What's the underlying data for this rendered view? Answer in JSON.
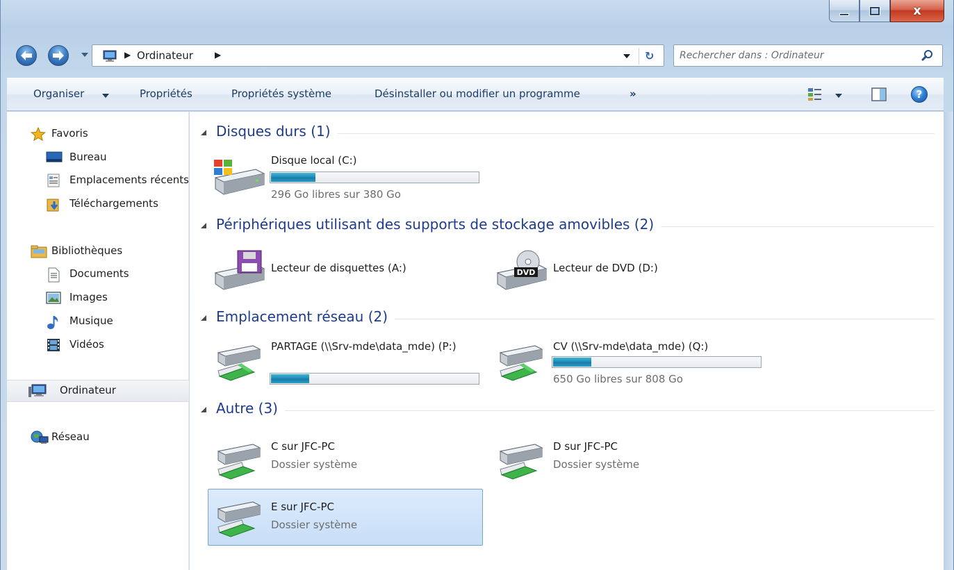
{
  "window": {
    "close_glyph": "x",
    "colors": {
      "accent": "#1e3c8c",
      "bar_fill": "#1f89b6",
      "selection": "#c7def7"
    }
  },
  "address": {
    "crumb": "Ordinateur",
    "chevron": "▶"
  },
  "search": {
    "placeholder": "Rechercher dans : Ordinateur"
  },
  "commands": {
    "organise": "Organiser",
    "properties": "Propriétés",
    "system_properties": "Propriétés système",
    "uninstall": "Désinstaller ou modifier un programme",
    "more": "»",
    "help": "?"
  },
  "nav": {
    "favorites": "Favoris",
    "desktop": "Bureau",
    "recent_places": "Emplacements récents",
    "downloads": "Téléchargements",
    "libraries": "Bibliothèques",
    "documents": "Documents",
    "images": "Images",
    "music": "Musique",
    "videos": "Vidéos",
    "computer": "Ordinateur",
    "network": "Réseau"
  },
  "groups": {
    "hard_drives": {
      "title": "Disques durs (1)",
      "items": [
        {
          "name": "Disque local (C:)",
          "detail": "296 Go libres sur 380 Go",
          "used_fraction": 0.22
        }
      ]
    },
    "removable": {
      "title": "Périphériques utilisant des supports de stockage amovibles (2)",
      "items": [
        {
          "name": "Lecteur de disquettes (A:)"
        },
        {
          "name": "Lecteur de DVD (D:)",
          "badge": "DVD"
        }
      ]
    },
    "network": {
      "title": "Emplacement réseau (2)",
      "items": [
        {
          "name": "PARTAGE (\\\\Srv-mde\\data_mde) (P:)",
          "used_fraction": 0.19
        },
        {
          "name": "CV (\\\\Srv-mde\\data_mde) (Q:)",
          "detail": "650 Go libres sur 808 Go",
          "used_fraction": 0.19
        }
      ]
    },
    "other": {
      "title": "Autre (3)",
      "items": [
        {
          "name": "C sur JFC-PC",
          "detail": "Dossier système"
        },
        {
          "name": "D sur JFC-PC",
          "detail": "Dossier système"
        },
        {
          "name": "E sur JFC-PC",
          "detail": "Dossier système",
          "selected": true
        }
      ]
    }
  }
}
